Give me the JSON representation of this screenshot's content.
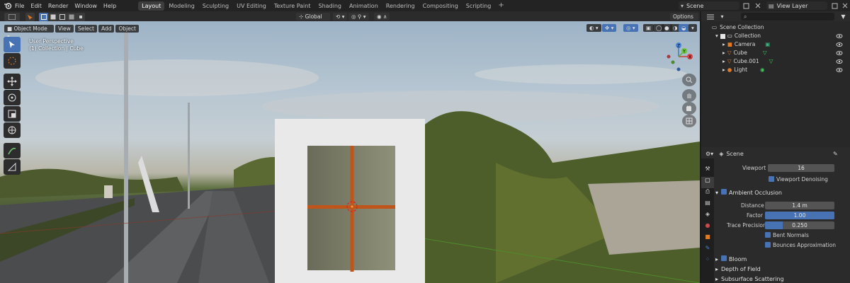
{
  "menu": [
    "File",
    "Edit",
    "Render",
    "Window",
    "Help"
  ],
  "workspace_tabs": [
    "Layout",
    "Modeling",
    "Sculpting",
    "UV Editing",
    "Texture Paint",
    "Shading",
    "Animation",
    "Rendering",
    "Compositing",
    "Scripting"
  ],
  "active_tab": "Layout",
  "scene_name": "Scene",
  "view_layer": "View Layer",
  "header": {
    "transform_orientation": "Global",
    "options_label": "Options"
  },
  "viewport_header": {
    "mode": "Object Mode",
    "items": [
      "View",
      "Select",
      "Add",
      "Object"
    ]
  },
  "overlay": {
    "perspective": "User Perspective",
    "context": "(1) Collection | Cube"
  },
  "outliner": {
    "root": "Scene Collection",
    "collection": "Collection",
    "items": [
      "Camera",
      "Cube",
      "Cube.001",
      "Light"
    ]
  },
  "properties": {
    "scene_label": "Scene",
    "viewport_label": "Viewport",
    "viewport_value": "16",
    "viewport_denoising": "Viewport Denoising",
    "ao_label": "Ambient Occlusion",
    "distance_label": "Distance",
    "distance_value": "1.4 m",
    "factor_label": "Factor",
    "factor_value": "1.00",
    "factor_fill": 1.0,
    "trace_label": "Trace Precision",
    "trace_value": "0.250",
    "trace_fill": 0.25,
    "bent_normals": "Bent Normals",
    "bounces": "Bounces Approximation",
    "bloom": "Bloom",
    "dof": "Depth of Field",
    "sss": "Subsurface Scattering"
  },
  "colors": {
    "accent": "#4772b3",
    "bg": "#1d1d1d",
    "panel": "#2b2b2b"
  }
}
